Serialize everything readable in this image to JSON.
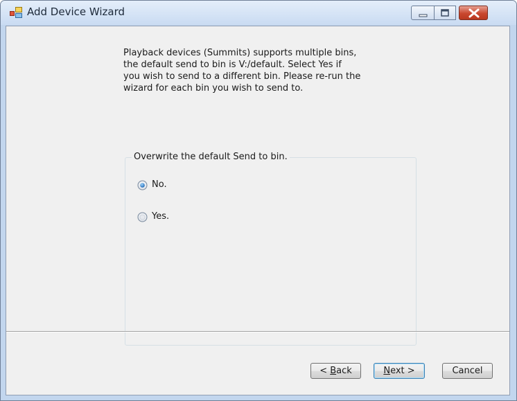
{
  "window": {
    "title": "Add Device Wizard",
    "icon": "wizard-app-icon",
    "controls": [
      "minimize-icon",
      "maximize-icon",
      "close-icon"
    ]
  },
  "description": "Playback devices (Summits) supports multiple bins,\nthe default send to bin is V:/default. Select Yes if\nyou wish to send to a different bin. Please re-run the\nwizard for each bin you wish to send to.",
  "group": {
    "label": "Overwrite the default Send to bin.",
    "options": [
      {
        "label": "No.",
        "checked": true
      },
      {
        "label": "Yes.",
        "checked": false
      }
    ]
  },
  "buttons": {
    "back": {
      "prefix": "< ",
      "mnemonic": "B",
      "rest": "ack"
    },
    "next": {
      "mnemonic": "N",
      "rest": "ext >"
    },
    "cancel": {
      "label": "Cancel"
    }
  },
  "colors": {
    "accent": "#3c7fb1",
    "close_button": "#c9472f",
    "dialog_background": "#f0f0f0"
  }
}
